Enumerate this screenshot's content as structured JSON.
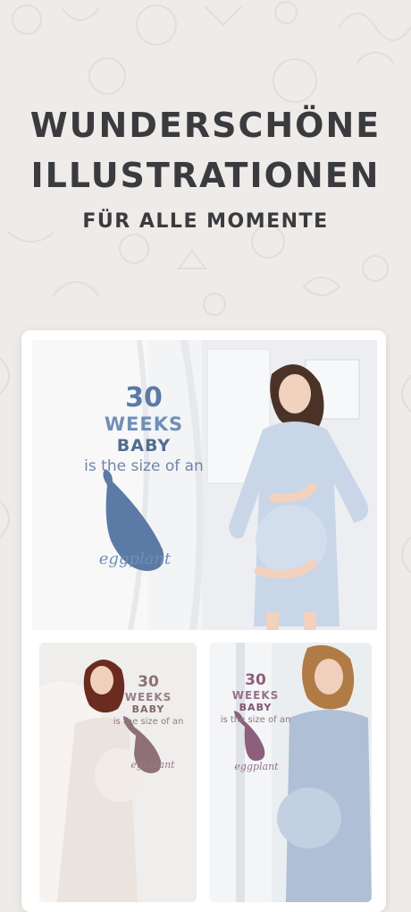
{
  "headline": {
    "line1": "WUNDERSCHÖNE",
    "line2": "ILLUSTRATIONEN",
    "line3": "FÜR ALLE MOMENTE"
  },
  "previews": [
    {
      "week": "30",
      "weeks_label": "WEEKS",
      "baby_label": "BABY",
      "size_text": "is the size of an",
      "fruit_label": "eggplant",
      "accent": "#5b7aa5",
      "fruit_icon": "eggplant-icon"
    },
    {
      "week": "30",
      "weeks_label": "WEEKS",
      "baby_label": "BABY",
      "size_text": "is the size of an",
      "fruit_label": "eggplant",
      "accent": "#8f6f78",
      "fruit_icon": "eggplant-icon"
    },
    {
      "week": "30",
      "weeks_label": "WEEKS",
      "baby_label": "BABY",
      "size_text": "is the size of an",
      "fruit_label": "eggplant",
      "accent": "#8c5f7c",
      "fruit_icon": "eggplant-icon"
    }
  ],
  "colors": {
    "background": "#eeebe8",
    "headline": "#3a3b3e"
  }
}
